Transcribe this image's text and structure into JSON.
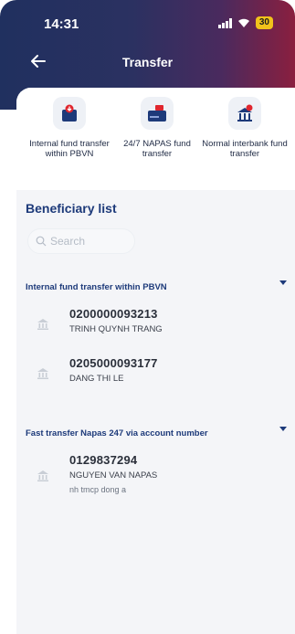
{
  "status_bar": {
    "time": "14:31",
    "battery": "30"
  },
  "nav": {
    "title": "Transfer"
  },
  "options": [
    {
      "label": "Internal fund transfer within PBVN",
      "icon": "internal-transfer-icon"
    },
    {
      "label": "24/7 NAPAS fund transfer",
      "icon": "napas-card-icon"
    },
    {
      "label": "Normal interbank fund transfer",
      "icon": "bank-building-icon"
    }
  ],
  "beneficiary": {
    "title": "Beneficiary list",
    "search_placeholder": "Search",
    "groups": [
      {
        "title": "Internal fund transfer within PBVN",
        "items": [
          {
            "account": "0200000093213",
            "name": "TRINH QUYNH TRANG"
          },
          {
            "account": "0205000093177",
            "name": "DANG THI LE"
          }
        ]
      },
      {
        "title": "Fast transfer Napas 247 via account number",
        "items": [
          {
            "account": "0129837294",
            "name": "NGUYEN VAN NAPAS",
            "bank": "nh tmcp dong a"
          }
        ]
      }
    ]
  },
  "colors": {
    "accent": "#1d3a7a",
    "header_start": "#20305f",
    "header_end": "#8a1f3f",
    "icon_red": "#e0262e"
  }
}
